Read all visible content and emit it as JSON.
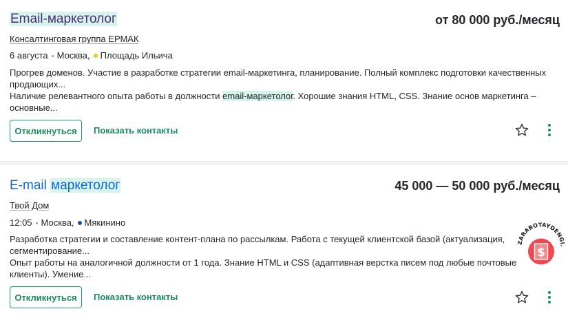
{
  "vacancies": [
    {
      "title_plain": "",
      "title_highlight": "Email-маркетолог",
      "salary": "от 80 000 руб./месяц",
      "company": "Консалтинговая группа ЕРМАК",
      "date": "6 августа",
      "city": "Москва,",
      "metro": "Площадь Ильича",
      "metro_color": "#f5c518",
      "desc_line1": "Прогрев доменов. Участие в разработке стратегии email-маркетинга, планирование. Полный комплекс подготовки качественных продающих...",
      "desc_line2_before": "Наличие релевантного опыта работы в должности ",
      "desc_line2_highlight": "email-маркетолог",
      "desc_line2_after": ". Хорошие знания HTML, CSS. Знание основ маркетинга – основные...",
      "respond_label": "Откликнуться",
      "contacts_label": "Показать контакты"
    },
    {
      "title_plain": "E-mail ",
      "title_highlight": "маркетолог",
      "salary": "45 000 — 50 000 руб./месяц",
      "company": "Твой Дом",
      "date": "12:05",
      "city": "Москва,",
      "metro": "Мякинино",
      "metro_color": "#1d4fa8",
      "desc_line1": "Разработка стратегии и составление контент-плана по рассылкам. Работа с текущей клиентской базой (актуализация, сегментирование...",
      "desc_line2_before": "Опыт работы на аналогичной должности от 1 года. Знание HTML и CSS (адаптивная верстка писем под любые почтовые клиенты). Умение...",
      "desc_line2_highlight": "",
      "desc_line2_after": "",
      "respond_label": "Откликнуться",
      "contacts_label": "Показать контакты"
    }
  ],
  "watermark": {
    "text": "ZARABOTAYDENGI.COM",
    "symbol": "$"
  },
  "colors": {
    "accent_green": "#1b8a5e",
    "visited_title": "#4a2f78",
    "link_title": "#0f67d6",
    "highlight": "#d6f3ec"
  }
}
